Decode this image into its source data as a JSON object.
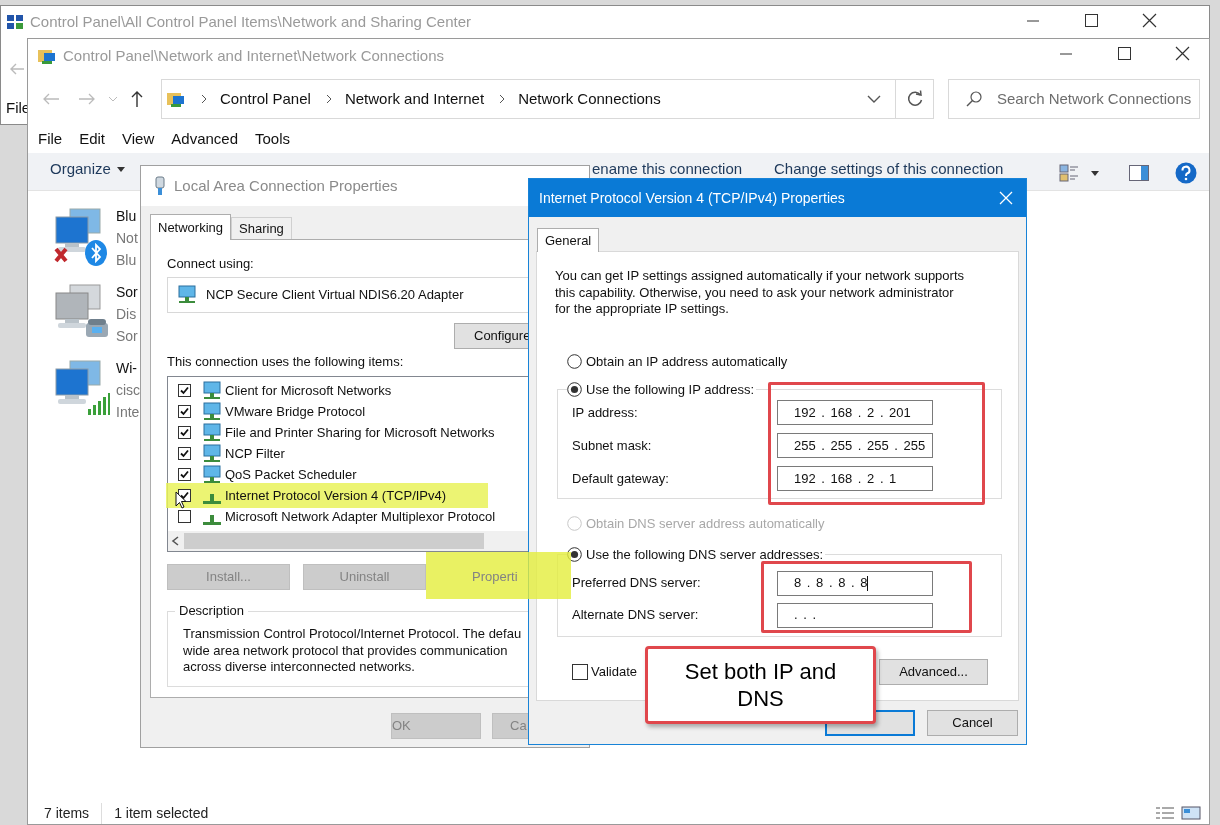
{
  "back_window": {
    "title": "Control Panel\\All Control Panel Items\\Network and Sharing Center",
    "menu_item": "File"
  },
  "explorer": {
    "title": "Control Panel\\Network and Internet\\Network Connections",
    "breadcrumb": [
      "Control Panel",
      "Network and Internet",
      "Network Connections"
    ],
    "search": {
      "placeholder": "Search Network Connections"
    },
    "menu": [
      "File",
      "Edit",
      "View",
      "Advanced",
      "Tools"
    ],
    "commands": [
      {
        "label": "Organize",
        "kind": "dropdown"
      },
      {
        "label": "ename this connection",
        "kind": "plain"
      },
      {
        "label": "Change settings of this connection",
        "kind": "plain"
      }
    ],
    "connections": [
      {
        "kind": "bluetooth",
        "lines": [
          "Blu",
          "Not",
          "Blu"
        ]
      },
      {
        "kind": "dialup",
        "lines": [
          "Sor",
          "Dis",
          "Sor"
        ]
      },
      {
        "kind": "wifi",
        "lines": [
          "Wi-",
          "cisc",
          "Inte"
        ]
      }
    ],
    "status": [
      "7 items",
      "1 item selected"
    ]
  },
  "lan_dialog": {
    "title": "Local Area Connection Properties",
    "tabs": [
      {
        "label": "Networking",
        "selected": true
      },
      {
        "label": "Sharing",
        "selected": false
      }
    ],
    "connect_label": "Connect using:",
    "adapter": "NCP Secure Client Virtual NDIS6.20 Adapter",
    "configure_button": "Configure",
    "items_label": "This connection uses the following items:",
    "items": [
      {
        "kind": "client",
        "label": "Client for Microsoft Networks",
        "checked": true,
        "highlighted": false
      },
      {
        "kind": "client",
        "label": "VMware Bridge Protocol",
        "checked": true,
        "highlighted": false
      },
      {
        "kind": "client",
        "label": "File and Printer Sharing for Microsoft Networks",
        "checked": true,
        "highlighted": false
      },
      {
        "kind": "client",
        "label": "NCP Filter",
        "checked": true,
        "highlighted": false
      },
      {
        "kind": "client",
        "label": "QoS Packet Scheduler",
        "checked": true,
        "highlighted": false
      },
      {
        "kind": "protocol",
        "label": "Internet Protocol Version 4 (TCP/IPv4)",
        "checked": true,
        "highlighted": true
      },
      {
        "kind": "protocol",
        "label": "Microsoft Network Adapter Multiplexor Protocol",
        "checked": false,
        "highlighted": false
      }
    ],
    "buttons": [
      {
        "label": "Install...",
        "disabled": true,
        "highlighted": false
      },
      {
        "label": "Uninstall",
        "disabled": true,
        "highlighted": false
      },
      {
        "label": "Properti",
        "disabled": true,
        "highlighted": true
      }
    ],
    "description": {
      "legend": "Description",
      "lines": [
        "Transmission Control Protocol/Internet Protocol. The defau",
        "wide area network protocol that provides communication",
        "across diverse interconnected networks."
      ]
    },
    "footer_buttons": [
      {
        "label": "OK",
        "disabled": true
      },
      {
        "label": "Ca",
        "disabled": true
      }
    ]
  },
  "ipv4_dialog": {
    "title": "Internet Protocol Version 4 (TCP/IPv4) Properties",
    "tab": "General",
    "intro": [
      "You can get IP settings assigned automatically if your network supports",
      "this capability. Otherwise, you need to ask your network administrator",
      "for the appropriate IP settings."
    ],
    "ip_options": [
      {
        "label": "Obtain an IP address automatically",
        "selected": false,
        "disabled": false
      },
      {
        "label": "Use the following IP address:",
        "selected": true,
        "disabled": false
      }
    ],
    "ip_fields": [
      {
        "label": "IP address:",
        "value": "192 . 168 . 2 . 201",
        "focused": false
      },
      {
        "label": "Subnet mask:",
        "value": "255 . 255 . 255 . 255",
        "focused": false
      },
      {
        "label": "Default gateway:",
        "value": "192 . 168 . 2 . 1",
        "focused": false
      }
    ],
    "dns_options": [
      {
        "label": "Obtain DNS server address automatically",
        "selected": false,
        "disabled": true
      },
      {
        "label": "Use the following DNS server addresses:",
        "selected": true,
        "disabled": false
      }
    ],
    "dns_fields": [
      {
        "label": "Preferred DNS server:",
        "value": "8 . 8 . 8 . 8",
        "focused": true
      },
      {
        "label": "Alternate DNS server:",
        "value": ". . .",
        "focused": false
      }
    ],
    "validate": {
      "label": "Validate",
      "checked": false
    },
    "advanced_button": "Advanced...",
    "cancel_button": "Cancel"
  },
  "callout": {
    "text": "Set both IP and DNS"
  }
}
